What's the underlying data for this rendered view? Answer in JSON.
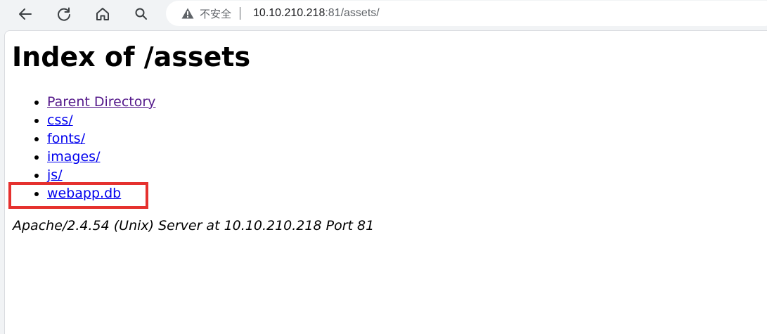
{
  "browser": {
    "security_label": "不安全",
    "url_host": "10.10.210.218",
    "url_rest": ":81/assets/",
    "icons": {
      "back": "back-arrow-icon",
      "reload": "reload-icon",
      "home": "home-icon",
      "search": "search-icon",
      "warning": "warning-triangle-icon"
    }
  },
  "page": {
    "title": "Index of /assets",
    "entries": [
      {
        "label": "Parent Directory",
        "visited": true
      },
      {
        "label": "css/"
      },
      {
        "label": "fonts/"
      },
      {
        "label": "images/"
      },
      {
        "label": "js/"
      },
      {
        "label": "webapp.db",
        "highlighted": true
      }
    ],
    "address": "Apache/2.4.54 (Unix) Server at 10.10.210.218 Port 81"
  },
  "colors": {
    "link": "#0000ee",
    "visited_link": "#551a8b",
    "highlight": "#e5312e"
  }
}
